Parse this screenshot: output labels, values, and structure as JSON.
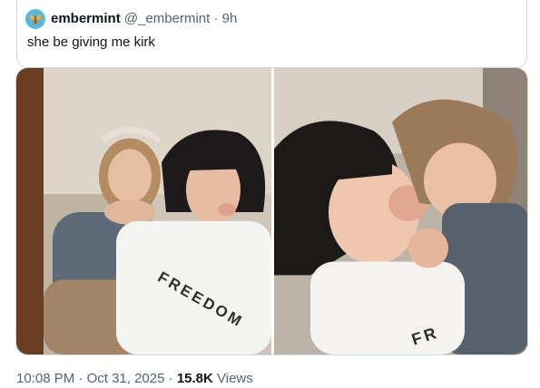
{
  "tweet": {
    "author_name": "embermint",
    "author_handle": "@_embermint",
    "separator": "·",
    "time_ago": "9h",
    "text": "she be giving me kirk"
  },
  "media": {
    "photos": [
      {
        "shirt_text": "FREEDOM"
      },
      {
        "shirt_text": "FR"
      }
    ]
  },
  "footer": {
    "time": "10:08 PM",
    "dot1": "·",
    "date": "Oct 31, 2025",
    "dot2": "·",
    "views_count": "15.8K",
    "views_label": "Views"
  }
}
